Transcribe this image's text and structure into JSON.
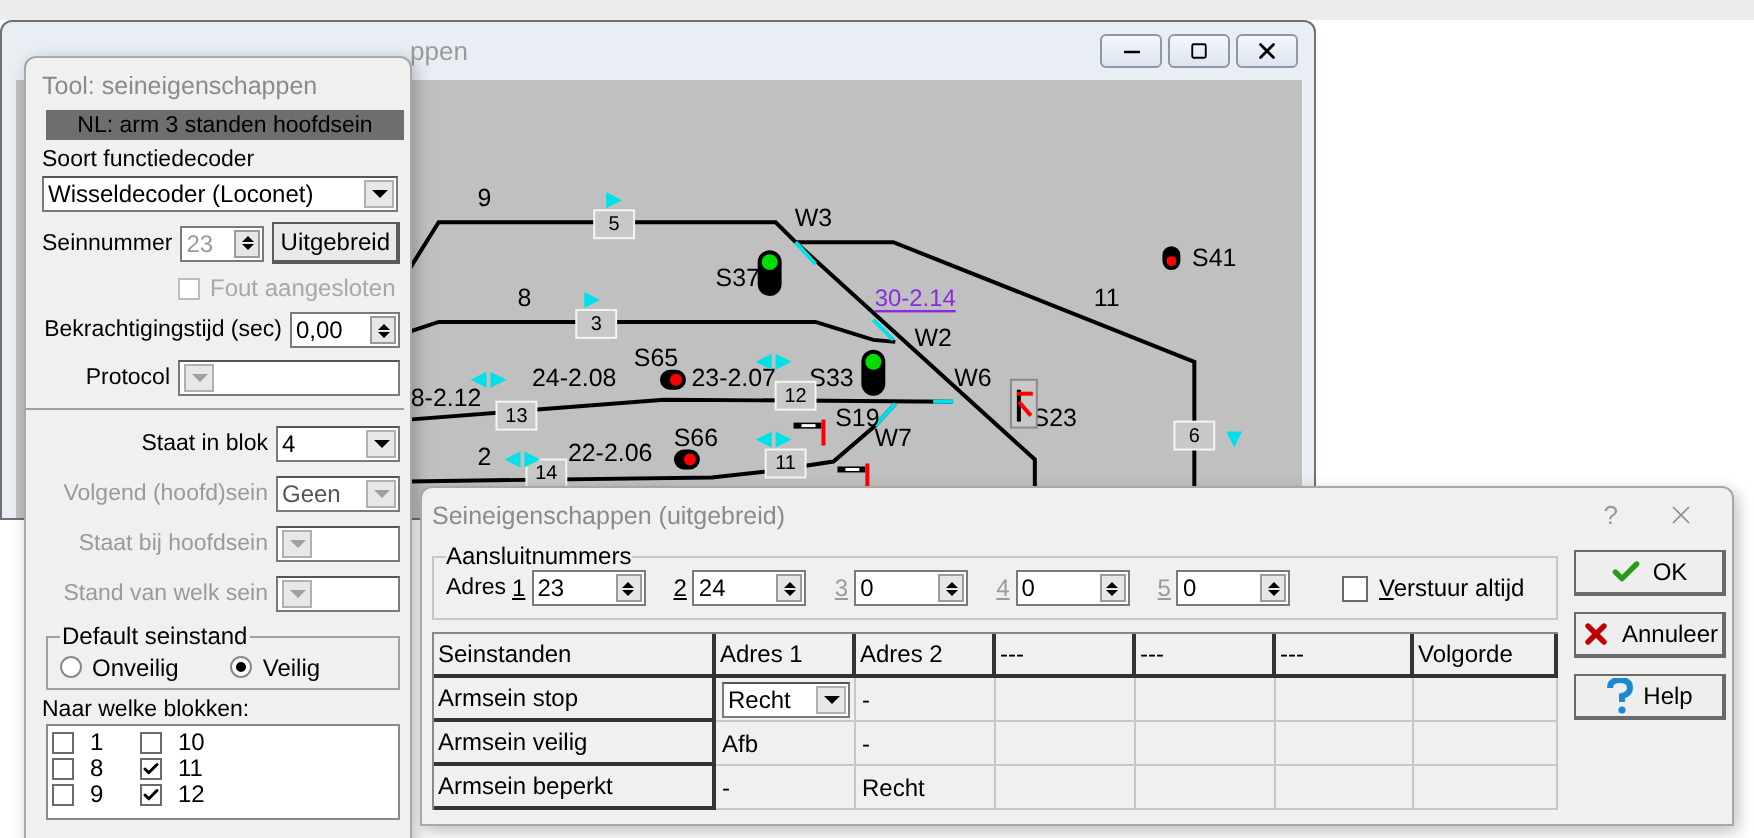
{
  "main_window": {
    "title_fragment": "ppen",
    "diagram": {
      "labels": [
        "9",
        "W3",
        "S41",
        "S37",
        "8",
        "11",
        "W2",
        "S65",
        "24-2.08",
        "23-2.07",
        "S33",
        "W6",
        "8-2.12",
        "S19",
        "S23",
        "S66",
        "W7",
        "2",
        "22-2.06"
      ],
      "link": "30-2.14",
      "blocks": [
        "5",
        "3",
        "12",
        "13",
        "6",
        "11",
        "14"
      ]
    }
  },
  "tool_window": {
    "title": "Tool: seineigenschappen",
    "header": "NL: arm 3 standen hoofdsein",
    "decoder_label": "Soort functiedecoder",
    "decoder": {
      "value": "Wisseldecoder (Loconet)",
      "disabled": false
    },
    "signal_number": {
      "label": "Seinnummer",
      "value": "23",
      "disabled": true
    },
    "extended_button": "Uitgebreid",
    "fault_checkbox": {
      "label": "Fout aangesloten",
      "checked": false,
      "disabled": true
    },
    "energize_time": {
      "label": "Bekrachtigingstijd (sec)",
      "value": "0,00"
    },
    "protocol": {
      "label": "Protocol",
      "disabled": true
    },
    "block_fields": [
      {
        "label": "Staat in blok",
        "value": "4",
        "disabled": false
      },
      {
        "label": "Volgend (hoofd)sein",
        "value": "Geen",
        "disabled": true
      },
      {
        "label": "Staat bij hoofdsein",
        "disabled": true
      },
      {
        "label": "Stand van welk sein",
        "disabled": true
      }
    ],
    "default_state": {
      "title": "Default seinstand",
      "options": [
        {
          "label": "Onveilig",
          "selected": false
        },
        {
          "label": "Veilig",
          "selected": true
        }
      ]
    },
    "blocks_label": "Naar welke blokken:",
    "blocks": [
      {
        "label": "1",
        "checked": false
      },
      {
        "label": "10",
        "checked": false
      },
      {
        "label": "8",
        "checked": false
      },
      {
        "label": "11",
        "checked": true
      },
      {
        "label": "9",
        "checked": false
      },
      {
        "label": "12",
        "checked": true
      }
    ]
  },
  "dialog": {
    "title": "Seineigenschappen (uitgebreid)",
    "help_mark": "?",
    "group_title": "Aansluitnummers",
    "address_prefix": "Adres",
    "addresses": [
      {
        "number": "1",
        "value": "23",
        "disabled": false
      },
      {
        "number": "2",
        "value": "24",
        "disabled": false
      },
      {
        "number": "3",
        "value": "0",
        "disabled": true
      },
      {
        "number": "4",
        "value": "0",
        "disabled": true
      },
      {
        "number": "5",
        "value": "0",
        "disabled": true
      }
    ],
    "send_always": {
      "label": "Verstuur altijd",
      "checked": false
    },
    "buttons": [
      {
        "label": "OK",
        "kind": "ok"
      },
      {
        "label": "Annuleer",
        "kind": "cancel"
      },
      {
        "label": "Help",
        "kind": "help"
      }
    ],
    "table": {
      "columns": [
        "Seinstanden",
        "Adres 1",
        "Adres 2",
        "---",
        "---",
        "---",
        "Volgorde"
      ],
      "rows": [
        {
          "cells": [
            {
              "kind": "header",
              "text": "Armsein stop"
            },
            {
              "kind": "dropdown",
              "text": "Recht"
            },
            {
              "kind": "text",
              "text": "-"
            },
            {
              "kind": "empty"
            },
            {
              "kind": "empty"
            },
            {
              "kind": "empty"
            },
            {
              "kind": "empty"
            }
          ]
        },
        {
          "cells": [
            {
              "kind": "header",
              "text": "Armsein veilig"
            },
            {
              "kind": "text",
              "text": "Afb"
            },
            {
              "kind": "text",
              "text": "-"
            },
            {
              "kind": "empty"
            },
            {
              "kind": "empty"
            },
            {
              "kind": "empty"
            },
            {
              "kind": "empty"
            }
          ]
        },
        {
          "cells": [
            {
              "kind": "header",
              "text": "Armsein beperkt"
            },
            {
              "kind": "text",
              "text": "-"
            },
            {
              "kind": "text",
              "text": "Recht"
            },
            {
              "kind": "empty"
            },
            {
              "kind": "empty"
            },
            {
              "kind": "empty"
            },
            {
              "kind": "empty"
            }
          ]
        }
      ]
    }
  }
}
